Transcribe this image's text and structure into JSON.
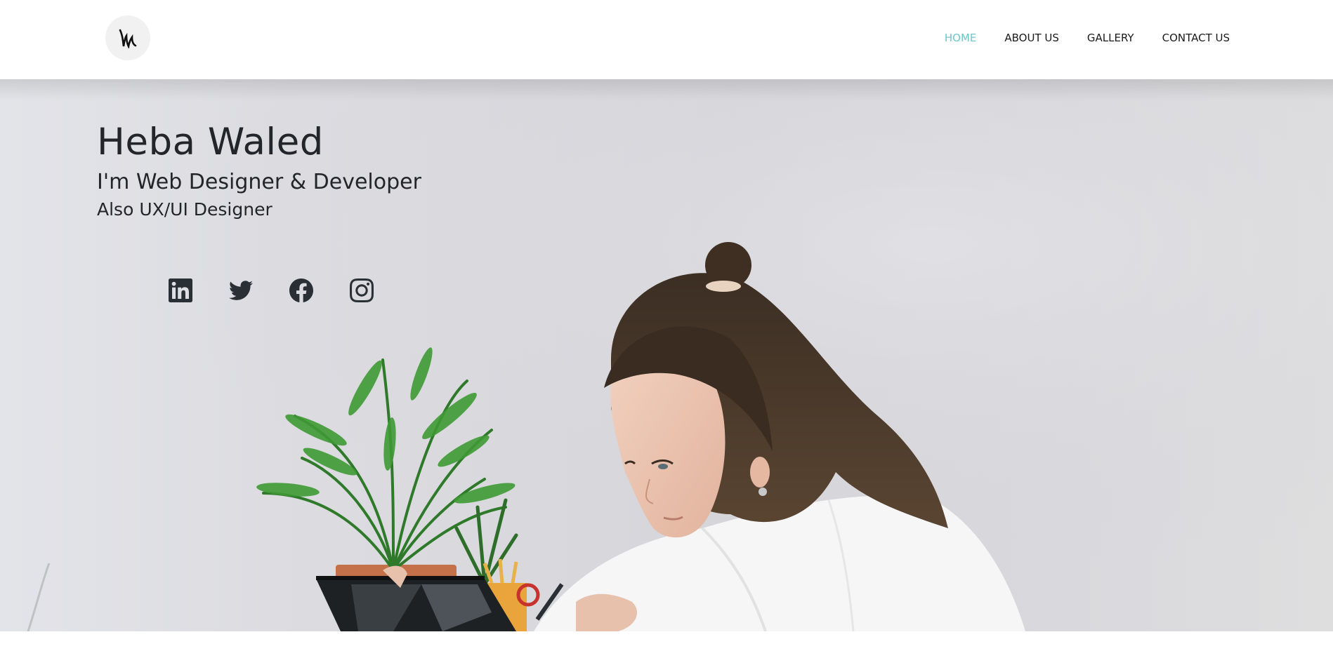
{
  "brand": {
    "logo_icon": "brush-stroke-w-logo-icon"
  },
  "nav": {
    "items": [
      {
        "label": "HOME",
        "active": true
      },
      {
        "label": "ABOUT US",
        "active": false
      },
      {
        "label": "GALLERY",
        "active": false
      },
      {
        "label": "CONTACT US",
        "active": false
      }
    ]
  },
  "hero": {
    "name": "Heba Waled",
    "role": "I'm Web Designer & Developer",
    "role_secondary": "Also UX/UI Designer",
    "social": [
      {
        "icon": "linkedin-icon"
      },
      {
        "icon": "twitter-icon"
      },
      {
        "icon": "facebook-icon"
      },
      {
        "icon": "instagram-icon"
      }
    ]
  },
  "colors": {
    "accent": "#6cc6cc",
    "text_dark": "#23252b",
    "nav_text": "#1b1b1b",
    "icon": "#2a2f36"
  }
}
